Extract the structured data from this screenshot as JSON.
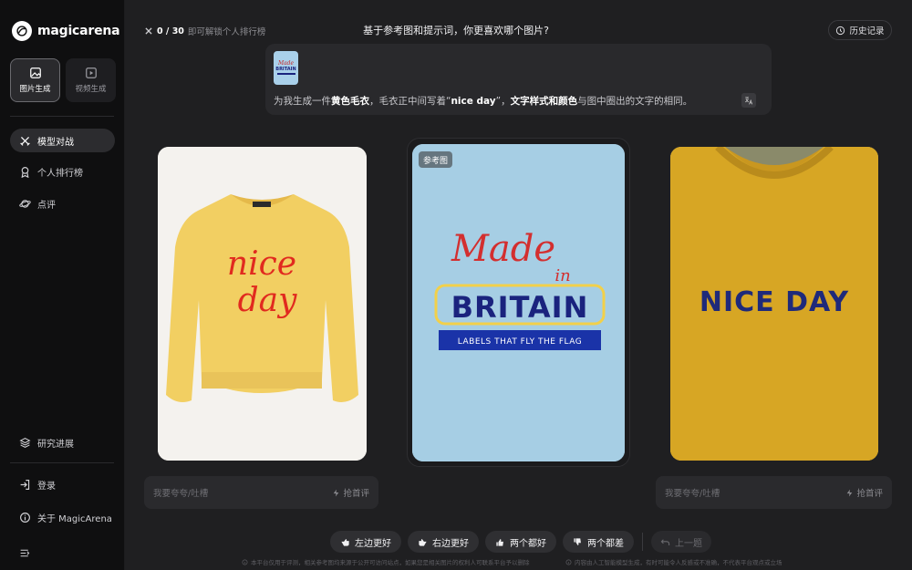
{
  "app": {
    "brand": "magicarena"
  },
  "sidebar": {
    "modes": [
      {
        "label": "图片生成",
        "icon": "image-icon",
        "active": true
      },
      {
        "label": "视频生成",
        "icon": "video-icon",
        "active": false
      }
    ],
    "nav": [
      {
        "label": "模型对战",
        "icon": "battle-icon",
        "active": true
      },
      {
        "label": "个人排行榜",
        "icon": "ranking-icon",
        "active": false
      },
      {
        "label": "点评",
        "icon": "planet-icon",
        "active": false
      }
    ],
    "bottom": [
      {
        "label": "研究进展",
        "icon": "layers-icon"
      },
      {
        "label": "登录",
        "icon": "login-icon"
      },
      {
        "label": "关于 MagicArena",
        "icon": "info-icon"
      }
    ],
    "collapse_icon": "collapse-icon"
  },
  "topbar": {
    "counter_value": "0 / 30",
    "counter_text": "即可解锁个人排行榜",
    "question": "基于参考图和提示词，你更喜欢哪个图片?",
    "history_label": "历史记录"
  },
  "prompt": {
    "segments": [
      {
        "text": "为我生成一件",
        "bold": false
      },
      {
        "text": "黄色毛衣",
        "bold": true
      },
      {
        "text": "，毛衣正中间写着“",
        "bold": false
      },
      {
        "text": "nice day",
        "bold": true
      },
      {
        "text": "”，",
        "bold": false
      },
      {
        "text": "文字样式和颜色",
        "bold": true
      },
      {
        "text": "与图中圈出的文字的相同。",
        "bold": false
      }
    ],
    "thumb_line1": "Made",
    "thumb_line2": "BRITAIN"
  },
  "images": {
    "left": {
      "text_line1": "nice",
      "text_line2": "day",
      "shirt_color": "#f2cf62",
      "text_color": "#e12a1f"
    },
    "reference": {
      "badge": "参考图",
      "line1": "Made",
      "line2": "in",
      "line3": "BRITAIN",
      "ribbon": "LABELS THAT FLY THE FLAG",
      "background": "#a6cee4"
    },
    "right": {
      "text": "NICE DAY",
      "shirt_color": "#d7a624"
    }
  },
  "comments": {
    "left": {
      "placeholder": "我要夸夸/吐槽",
      "first_label": "抢首评"
    },
    "right": {
      "placeholder": "我要夸夸/吐槽",
      "first_label": "抢首评"
    }
  },
  "votes": [
    {
      "label": "左边更好",
      "icon": "thumb-left-icon"
    },
    {
      "label": "右边更好",
      "icon": "thumb-right-icon"
    },
    {
      "label": "两个都好",
      "icon": "double-thumb-up-icon"
    },
    {
      "label": "两个都差",
      "icon": "thumb-down-icon"
    },
    {
      "label": "上一题",
      "icon": "undo-icon"
    }
  ],
  "disclaimers": {
    "left": "本平台仅用于评测，相关参考图均来源于公开可访问站点，如果您是相关图片的权利人可联系平台予以删除",
    "right": "内容由人工智能模型生成，有时可能令人反感或不准确，不代表平台观点或立场"
  }
}
